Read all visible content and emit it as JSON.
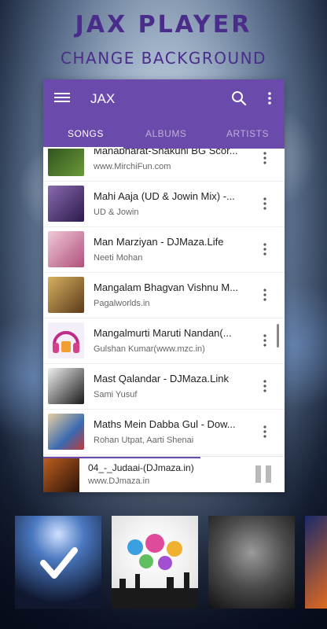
{
  "header": {
    "title": "JAX PLAYER",
    "subtitle": "CHANGE BACKGROUND"
  },
  "toolbar": {
    "title": "JAX",
    "menu_icon": "hamburger-menu-icon",
    "search_icon": "search-icon",
    "more_icon": "more-vert-icon"
  },
  "tabs": [
    {
      "label": "SONGS",
      "active": true
    },
    {
      "label": "ALBUMS",
      "active": false
    },
    {
      "label": "ARTISTS",
      "active": false
    }
  ],
  "songs": [
    {
      "title": "Mahabharat-Shakuni BG Scor...",
      "subtitle": "www.MirchiFun.com",
      "art_color": "#3a6a2a"
    },
    {
      "title": "Mahi Aaja (UD & Jowin Mix) -...",
      "subtitle": "UD & Jowin",
      "art_color": "#5a3a7a"
    },
    {
      "title": "Man Marziyan - DJMaza.Life",
      "subtitle": "Neeti Mohan",
      "art_color": "#c06a90"
    },
    {
      "title": "Mangalam Bhagvan Vishnu M...",
      "subtitle": "Pagalworlds.in",
      "art_color": "#8a6a30"
    },
    {
      "title": "Mangalmurti Maruti Nandan(...",
      "subtitle": "Gulshan Kumar(www.mzc.in)",
      "art_color": "#f2eef7"
    },
    {
      "title": "Mast Qalandar - DJMaza.Link",
      "subtitle": "Sami Yusuf",
      "art_color": "#2a2a2a"
    },
    {
      "title": "Maths Mein Dabba Gul -  Dow...",
      "subtitle": "Rohan Utpat, Aarti Shenai",
      "art_color": "#4a7ab0"
    }
  ],
  "now_playing": {
    "title": "04_-_Judaai-(DJmaza.in)",
    "subtitle": "www.DJmaza.in",
    "progress": 0.65,
    "pause_icon": "pause-icon"
  },
  "backgrounds": [
    {
      "name": "concert-crowd",
      "selected": true,
      "check_icon": "checkmark-icon"
    },
    {
      "name": "dance-silhouettes",
      "selected": false
    },
    {
      "name": "party-crowd-bw",
      "selected": false
    },
    {
      "name": "neon-lights",
      "selected": false
    }
  ],
  "colors": {
    "accent": "#6a4aaa",
    "title_color": "#4a2c8a"
  }
}
